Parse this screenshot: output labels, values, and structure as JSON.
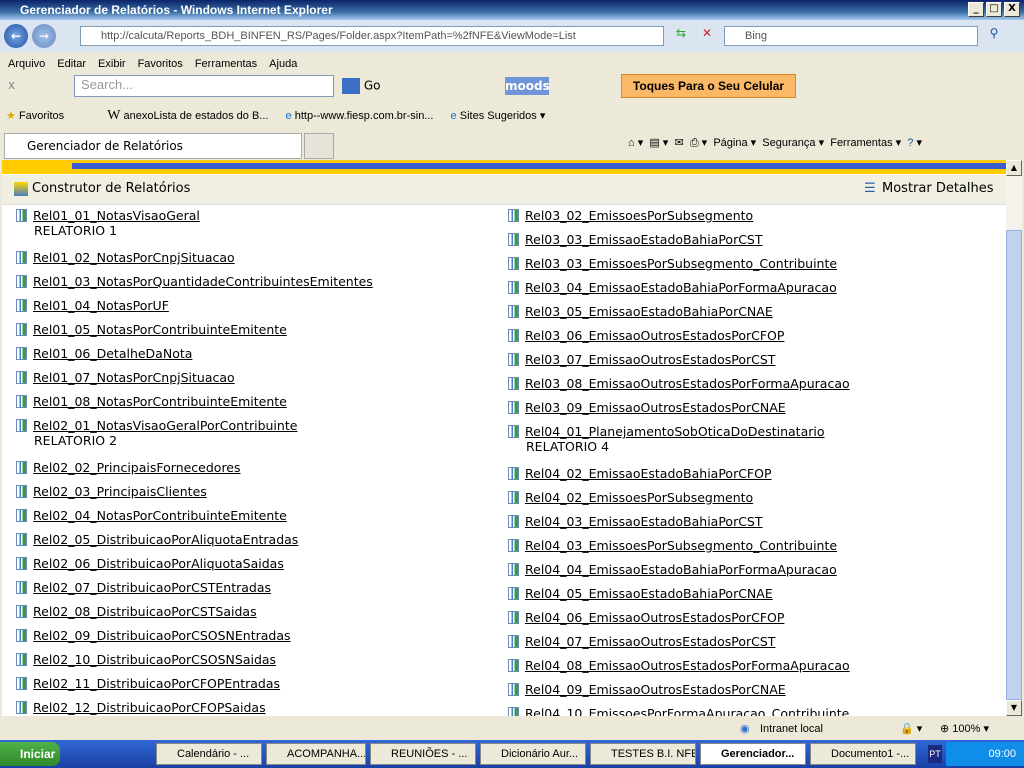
{
  "window": {
    "title": "Gerenciador de Relatórios - Windows Internet Explorer"
  },
  "address": {
    "url": "http://calcuta/Reports_BDH_BINFEN_RS/Pages/Folder.aspx?ItemPath=%2fNFE&ViewMode=List",
    "search_placeholder": "Bing"
  },
  "menu": [
    "Arquivo",
    "Editar",
    "Exibir",
    "Favoritos",
    "Ferramentas",
    "Ajuda"
  ],
  "toolbar2": {
    "search_placeholder": "Search...",
    "go": "Go",
    "moods": "moods",
    "toques": "Toques Para o Seu Celular"
  },
  "favorites": {
    "label": "Favoritos",
    "links": [
      "anexoLista de estados do B...",
      "http--www.fiesp.com.br-sin...",
      "Sites Sugeridos"
    ]
  },
  "tab": {
    "label": "Gerenciador de Relatórios"
  },
  "commandbar": [
    "Página",
    "Segurança",
    "Ferramentas"
  ],
  "page": {
    "builder": "Construtor de Relatórios",
    "details": "Mostrar Detalhes"
  },
  "left": [
    {
      "name": "Rel01_01_NotasVisaoGeral",
      "desc": "RELATORIO 1"
    },
    {
      "name": "Rel01_02_NotasPorCnpjSituacao"
    },
    {
      "name": "Rel01_03_NotasPorQuantidadeContribuintesEmitentes"
    },
    {
      "name": "Rel01_04_NotasPorUF"
    },
    {
      "name": "Rel01_05_NotasPorContribuinteEmitente"
    },
    {
      "name": "Rel01_06_DetalheDaNota"
    },
    {
      "name": "Rel01_07_NotasPorCnpjSituacao"
    },
    {
      "name": "Rel01_08_NotasPorContribuinteEmitente"
    },
    {
      "name": "Rel02_01_NotasVisaoGeralPorContribuinte",
      "desc": "RELATORIO 2"
    },
    {
      "name": "Rel02_02_PrincipaisFornecedores"
    },
    {
      "name": "Rel02_03_PrincipaisClientes"
    },
    {
      "name": "Rel02_04_NotasPorContribuinteEmitente"
    },
    {
      "name": "Rel02_05_DistribuicaoPorAliquotaEntradas"
    },
    {
      "name": "Rel02_06_DistribuicaoPorAliquotaSaidas"
    },
    {
      "name": "Rel02_07_DistribuicaoPorCSTEntradas"
    },
    {
      "name": "Rel02_08_DistribuicaoPorCSTSaidas"
    },
    {
      "name": "Rel02_09_DistribuicaoPorCSOSNEntradas"
    },
    {
      "name": "Rel02_10_DistribuicaoPorCSOSNSaidas"
    },
    {
      "name": "Rel02_11_DistribuicaoPorCFOPEntradas"
    },
    {
      "name": "Rel02_12_DistribuicaoPorCFOPSaidas"
    }
  ],
  "right": [
    {
      "name": "Rel03_02_EmissoesPorSubsegmento"
    },
    {
      "name": "Rel03_03_EmissaoEstadoBahiaPorCST"
    },
    {
      "name": "Rel03_03_EmissoesPorSubsegmento_Contribuinte"
    },
    {
      "name": "Rel03_04_EmissaoEstadoBahiaPorFormaApuracao"
    },
    {
      "name": "Rel03_05_EmissaoEstadoBahiaPorCNAE"
    },
    {
      "name": "Rel03_06_EmissaoOutrosEstadosPorCFOP"
    },
    {
      "name": "Rel03_07_EmissaoOutrosEstadosPorCST"
    },
    {
      "name": "Rel03_08_EmissaoOutrosEstadosPorFormaApuracao"
    },
    {
      "name": "Rel03_09_EmissaoOutrosEstadosPorCNAE"
    },
    {
      "name": "Rel04_01_PlanejamentoSobOticaDoDestinatario",
      "desc": "RELATORIO 4"
    },
    {
      "name": "Rel04_02_EmissaoEstadoBahiaPorCFOP"
    },
    {
      "name": "Rel04_02_EmissoesPorSubsegmento"
    },
    {
      "name": "Rel04_03_EmissaoEstadoBahiaPorCST"
    },
    {
      "name": "Rel04_03_EmissoesPorSubsegmento_Contribuinte"
    },
    {
      "name": "Rel04_04_EmissaoEstadoBahiaPorFormaApuracao"
    },
    {
      "name": "Rel04_05_EmissaoEstadoBahiaPorCNAE"
    },
    {
      "name": "Rel04_06_EmissaoOutrosEstadosPorCFOP"
    },
    {
      "name": "Rel04_07_EmissaoOutrosEstadosPorCST"
    },
    {
      "name": "Rel04_08_EmissaoOutrosEstadosPorFormaApuracao"
    },
    {
      "name": "Rel04_09_EmissaoOutrosEstadosPorCNAE"
    },
    {
      "name": "Rel04_10_EmissoesPorFormaApuracao_Contribuinte"
    }
  ],
  "status": {
    "zone": "Intranet local",
    "zoom": "100%"
  },
  "taskbar": {
    "start": "Iniciar",
    "tasks": [
      "Calendário - ...",
      "ACOMPANHA...",
      "REUNIÕES - ...",
      "Dicionário Aur...",
      "TESTES B.I. NFE",
      "Gerenciador...",
      "Documento1 -..."
    ],
    "lang": "PT",
    "clock": "09:00"
  }
}
